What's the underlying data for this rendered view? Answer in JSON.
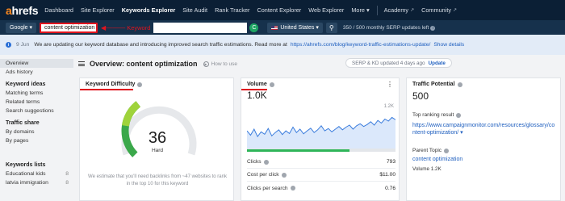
{
  "brand": {
    "logo_a": "a",
    "logo_rest": "hrefs"
  },
  "nav": {
    "items": [
      "Dashboard",
      "Site Explorer",
      "Keywords Explorer",
      "Site Audit",
      "Rank Tracker",
      "Content Explorer",
      "Web Explorer",
      "More"
    ],
    "active_index": 2,
    "right_items": [
      "Academy",
      "Community"
    ],
    "more_caret": "▾",
    "ext_glyph": "↗"
  },
  "search": {
    "engine": "Google ▾",
    "keyword": "content optimization",
    "annotation_arrow": "◀———",
    "annotation": "Keyword",
    "clear_glyph": "C",
    "country": "United States ▾",
    "search_glyph": "⚲",
    "usage": "350 / 500 monthly SERP updates left"
  },
  "notice": {
    "icon": "i",
    "date": "9 Jun",
    "text": "We are updating our keyword database and introducing improved search traffic estimations. Read more at",
    "link": "https://ahrefs.com/blog/keyword-traffic-estimations-update/",
    "show_details": "Show details"
  },
  "sidebar": {
    "top_items": [
      "Overview",
      "Ads history"
    ],
    "sections": [
      {
        "title": "Keyword ideas",
        "items": [
          "Matching terms",
          "Related terms",
          "Search suggestions"
        ]
      },
      {
        "title": "Traffic share",
        "items": [
          "By domains",
          "By pages"
        ]
      }
    ],
    "lists_title": "Keywords lists",
    "lists": [
      {
        "name": "Educational kids",
        "count": "8"
      },
      {
        "name": "latvia immigration",
        "count": "8"
      }
    ]
  },
  "main": {
    "title": "Overview: content optimization",
    "how_to": "How to use",
    "serp_status": "SERP & KD updated 4 days ago",
    "update_label": "Update"
  },
  "kd": {
    "title": "Keyword Difficulty",
    "value": "36",
    "score": 36,
    "label": "Hard",
    "description": "We estimate that you'll need backlinks from ~47 websites to rank in the top 10 for this keyword"
  },
  "volume": {
    "title": "Volume",
    "value": "1.0K",
    "chart_max_label": "1.2K",
    "menu": "⋮",
    "clicks_share": 0.69,
    "metrics": [
      {
        "label": "Clicks",
        "value": "793"
      },
      {
        "label": "Cost per click",
        "value": "$11.00"
      },
      {
        "label": "Clicks per search",
        "value": "0.76"
      }
    ],
    "chart_data": {
      "type": "line",
      "series": [
        {
          "values": [
            0.55,
            0.42,
            0.6,
            0.38,
            0.52,
            0.45,
            0.62,
            0.4,
            0.5,
            0.58,
            0.44,
            0.55,
            0.47,
            0.66,
            0.5,
            0.6,
            0.46,
            0.55,
            0.63,
            0.5,
            0.58,
            0.7,
            0.55,
            0.62,
            0.52,
            0.6,
            0.68,
            0.58,
            0.66,
            0.72,
            0.6,
            0.7,
            0.76,
            0.68,
            0.74,
            0.82,
            0.72,
            0.86,
            0.78,
            0.9,
            0.84,
            0.95,
            0.88
          ]
        }
      ],
      "ymax": 1.2
    }
  },
  "traffic": {
    "title": "Traffic Potential",
    "value": "500",
    "top_result_label": "Top ranking result",
    "top_result_url": "https://www.campaignmonitor.com/resources/glossary/content-optimization/ ▾",
    "parent_label": "Parent Topic",
    "parent_topic": "content optimization",
    "parent_volume": "Volume 1.2K"
  }
}
